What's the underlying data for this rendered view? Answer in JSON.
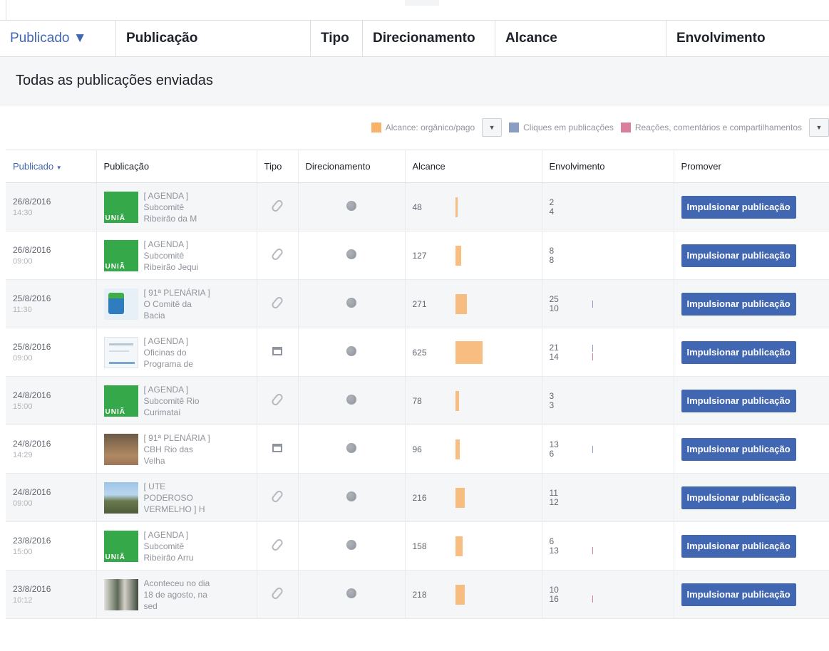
{
  "sticky_header": {
    "columns": [
      "Publicado ▼",
      "Publicação",
      "Tipo",
      "Direcionamento",
      "Alcance",
      "Envolvimento"
    ]
  },
  "section_title": "Todas as publicações enviadas",
  "legend": {
    "items": [
      {
        "label": "Alcance: orgânico/pago",
        "color": "#f7b36b"
      },
      {
        "label": "Cliques em publicações",
        "color": "#8b9dc3"
      },
      {
        "label": "Reações, comentários e compartilhamentos",
        "color": "#d87f9e"
      }
    ],
    "dropdown_icon": "▼"
  },
  "table": {
    "headers": [
      "Publicado",
      "Publicação",
      "Tipo",
      "Direcionamento",
      "Alcance",
      "Envolvimento",
      "Promover"
    ],
    "sort_caret": "▼",
    "boost_label": "Impulsionar publicação",
    "rows": [
      {
        "date": "26/8/2016",
        "time": "14:30",
        "thumb": "green",
        "thumb_text": "UNIÃ",
        "text": "[ AGENDA ] Subcomitê Ribeirão da M",
        "type": "link",
        "reach": "48",
        "reach_fraction": 0.08,
        "clicks": "2",
        "reactions": "4",
        "click_fraction": 0,
        "reaction_fraction": 0
      },
      {
        "date": "26/8/2016",
        "time": "09:00",
        "thumb": "green",
        "thumb_text": "UNIÃ",
        "text": "[ AGENDA ] Subcomitê Ribeirão Jequi",
        "type": "link",
        "reach": "127",
        "reach_fraction": 0.2,
        "clicks": "8",
        "reactions": "8",
        "click_fraction": 0,
        "reaction_fraction": 0
      },
      {
        "date": "25/8/2016",
        "time": "11:30",
        "thumb": "logo",
        "thumb_text": "",
        "text": "[ 91ª PLENÁRIA ] O Comitê da Bacia",
        "type": "link",
        "reach": "271",
        "reaction_note": "",
        "reach_fraction": 0.43,
        "clicks": "25",
        "reactions": "10",
        "click_fraction": 0.5,
        "reaction_fraction": 0
      },
      {
        "date": "25/8/2016",
        "time": "09:00",
        "thumb": "doc",
        "thumb_text": "",
        "text": "[ AGENDA ] Oficinas do Programa de",
        "type": "album",
        "reach": "625",
        "reach_fraction": 1,
        "clicks": "21",
        "reactions": "14",
        "click_fraction": 0.5,
        "reaction_fraction": 0.5
      },
      {
        "date": "24/8/2016",
        "time": "15:00",
        "thumb": "green",
        "thumb_text": "UNIÃ",
        "text": "[ AGENDA ] Subcomitê Rio Curimataí",
        "type": "link",
        "reach": "78",
        "reach_fraction": 0.12,
        "clicks": "3",
        "reactions": "3",
        "click_fraction": 0,
        "reaction_fraction": 0
      },
      {
        "date": "24/8/2016",
        "time": "14:29",
        "thumb": "dirt",
        "thumb_text": "",
        "text": "[ 91ª PLENÁRIA ] CBH Rio das Velha",
        "type": "album",
        "reach": "96",
        "reach_fraction": 0.15,
        "clicks": "13",
        "reactions": "6",
        "click_fraction": 0.5,
        "reaction_fraction": 0
      },
      {
        "date": "24/8/2016",
        "time": "09:00",
        "thumb": "land",
        "thumb_text": "",
        "text": "[ UTE PODEROSO VERMELHO ] H",
        "type": "link",
        "reach": "216",
        "reach_fraction": 0.35,
        "clicks": "11",
        "reactions": "12",
        "click_fraction": 0,
        "reaction_fraction": 0
      },
      {
        "date": "23/8/2016",
        "time": "15:00",
        "thumb": "green",
        "thumb_text": "UNIÃ",
        "text": "[ AGENDA ] Subcomitê Ribeirão Arru",
        "type": "link",
        "reach": "158",
        "reach_fraction": 0.25,
        "clicks": "6",
        "reactions": "13",
        "click_fraction": 0,
        "reaction_fraction": 0.5
      },
      {
        "date": "23/8/2016",
        "time": "10:12",
        "thumb": "people",
        "thumb_text": "",
        "text": "Aconteceu no dia 18 de agosto, na sed",
        "type": "link",
        "reach": "218",
        "reach_fraction": 0.35,
        "clicks": "10",
        "reactions": "16",
        "click_fraction": 0,
        "reaction_fraction": 0.5
      }
    ]
  }
}
